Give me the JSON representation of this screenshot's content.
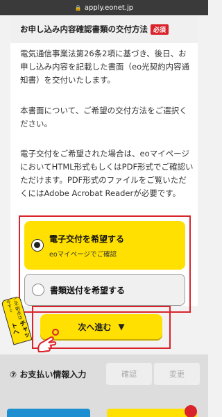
{
  "browser": {
    "url": "apply.eonet.jp"
  },
  "section": {
    "title": "お申し込み内容確認書類の交付方法",
    "required_badge": "必須",
    "paragraphs": [
      "電気通信事業法第26条2項に基づき、後日、お申し込み内容を記載した書面（eo光契約内容通知書）を交付いたします。",
      "本書面について、ご希望の交付方法をご選択ください。",
      "電子交付をご希望された場合は、eoマイページにおいてHTML形式もしくはPDF形式でご確認いただけます。PDF形式のファイルをご覧いただくにはAdobe Acrobat Readerが必要です。"
    ],
    "options": [
      {
        "label": "電子交付を希望する",
        "sublabel": "eoマイページでご確認",
        "selected": true
      },
      {
        "label": "書類送付を希望する",
        "selected": false
      }
    ]
  },
  "chat_tab": {
    "line1": "ご不明点は今すぐ",
    "line2": "チャットへ"
  },
  "next_button": {
    "label": "次へ進む",
    "arrow": "▼"
  },
  "payment": {
    "title": "⑦ お支払い情報入力",
    "confirm_label": "確認",
    "change_label": "変更"
  },
  "colors": {
    "accent": "#ffe000",
    "required": "#d8242a",
    "blue": "#1d8fd1"
  }
}
